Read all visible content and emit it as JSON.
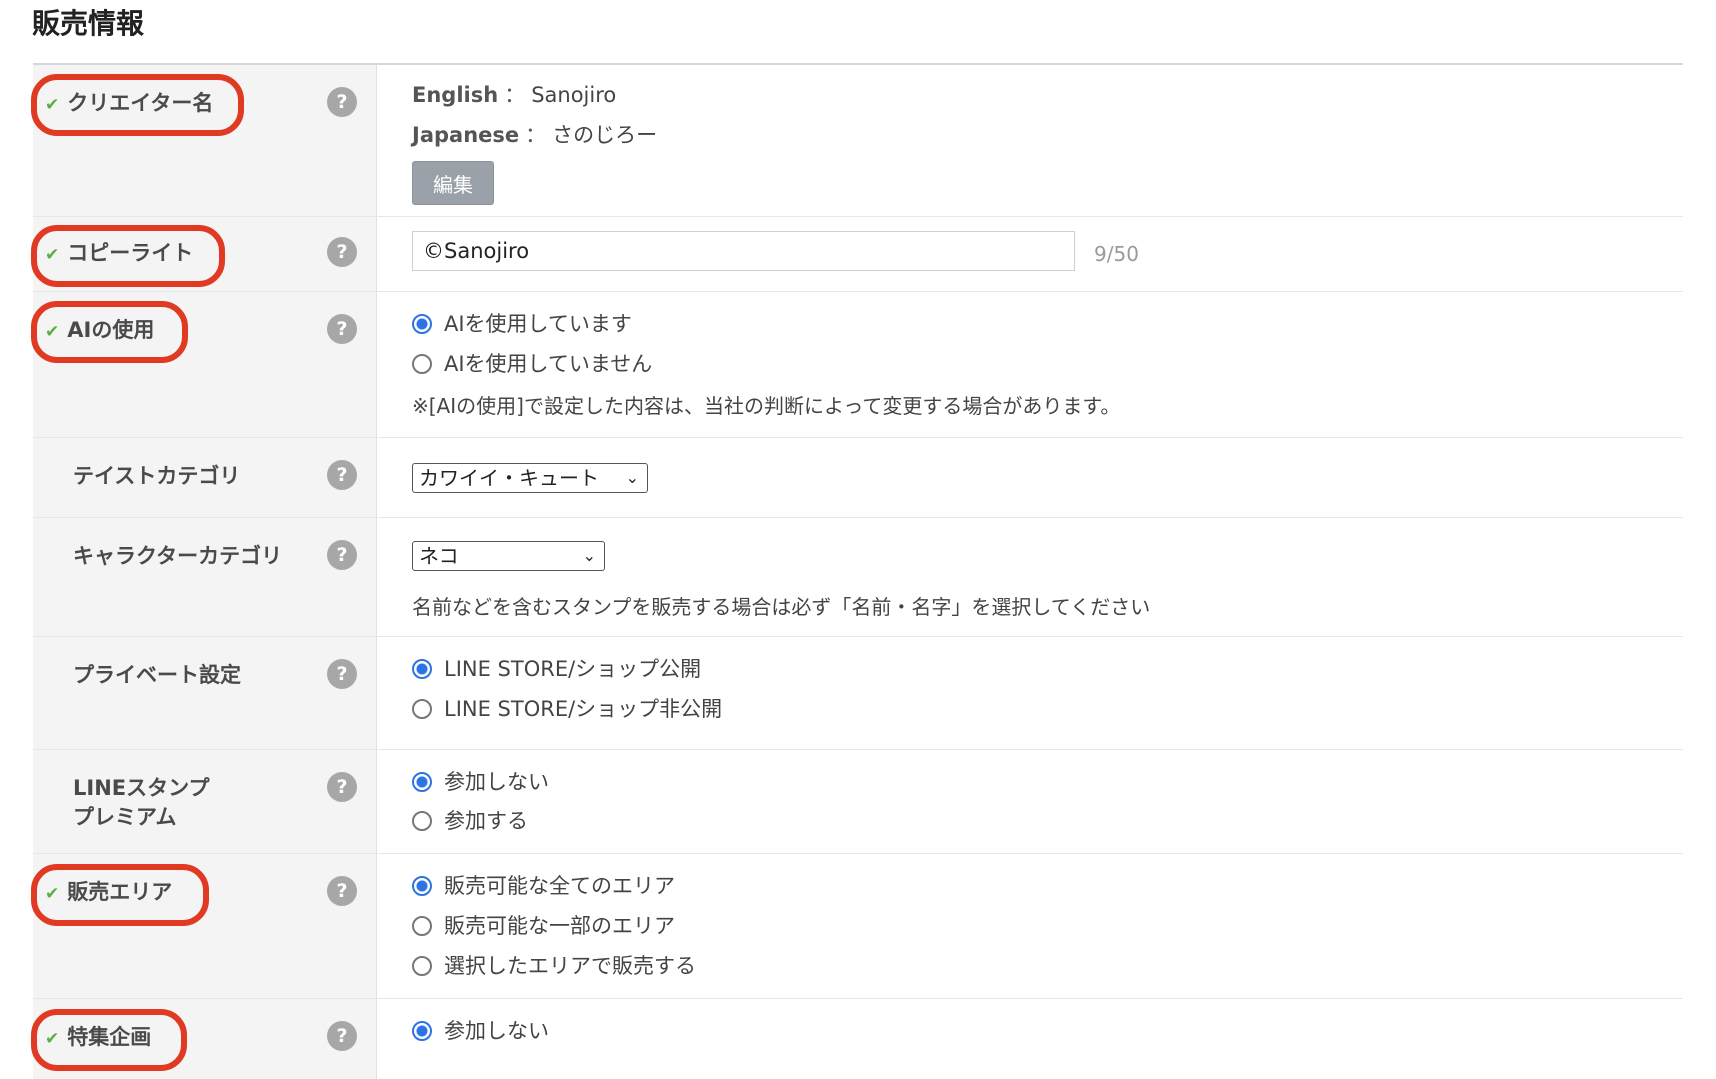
{
  "page_title": "販売情報",
  "help_glyph": "?",
  "check_glyph": "✔",
  "colors": {
    "highlight_border": "#e03a22",
    "check": "#5cae42",
    "radio_selected": "#2c73e3",
    "label_bg": "#f4f4f4"
  },
  "creator_name": {
    "label": "クリエイター名",
    "english_key": "English",
    "english_value": "Sanojiro",
    "japanese_key": "Japanese",
    "japanese_value": "さのじろー",
    "separator": "：",
    "edit_button": "編集"
  },
  "copyright": {
    "label": "コピーライト",
    "value": "©Sanojiro",
    "counter": "9/50"
  },
  "ai_use": {
    "label": "AIの使用",
    "options": [
      "AIを使用しています",
      "AIを使用していません"
    ],
    "selected_index": 0,
    "note": "※[AIの使用]で設定した内容は、当社の判断によって変更する場合があります。"
  },
  "taste_category": {
    "label": "テイストカテゴリ",
    "selected": "カワイイ・キュート"
  },
  "character_category": {
    "label": "キャラクターカテゴリ",
    "selected": "ネコ",
    "note": "名前などを含むスタンプを販売する場合は必ず「名前・名字」を選択してください"
  },
  "private_setting": {
    "label": "プライベート設定",
    "options": [
      "LINE STORE/ショップ公開",
      "LINE STORE/ショップ非公開"
    ],
    "selected_index": 0
  },
  "premium": {
    "label_line1": "LINEスタンプ",
    "label_line2": "プレミアム",
    "options": [
      "参加しない",
      "参加する"
    ],
    "selected_index": 0
  },
  "sales_area": {
    "label": "販売エリア",
    "options": [
      "販売可能な全てのエリア",
      "販売可能な一部のエリア",
      "選択したエリアで販売する"
    ],
    "selected_index": 0
  },
  "feature_campaign": {
    "label": "特集企画",
    "options": [
      "参加しない"
    ],
    "selected_index": 0
  }
}
